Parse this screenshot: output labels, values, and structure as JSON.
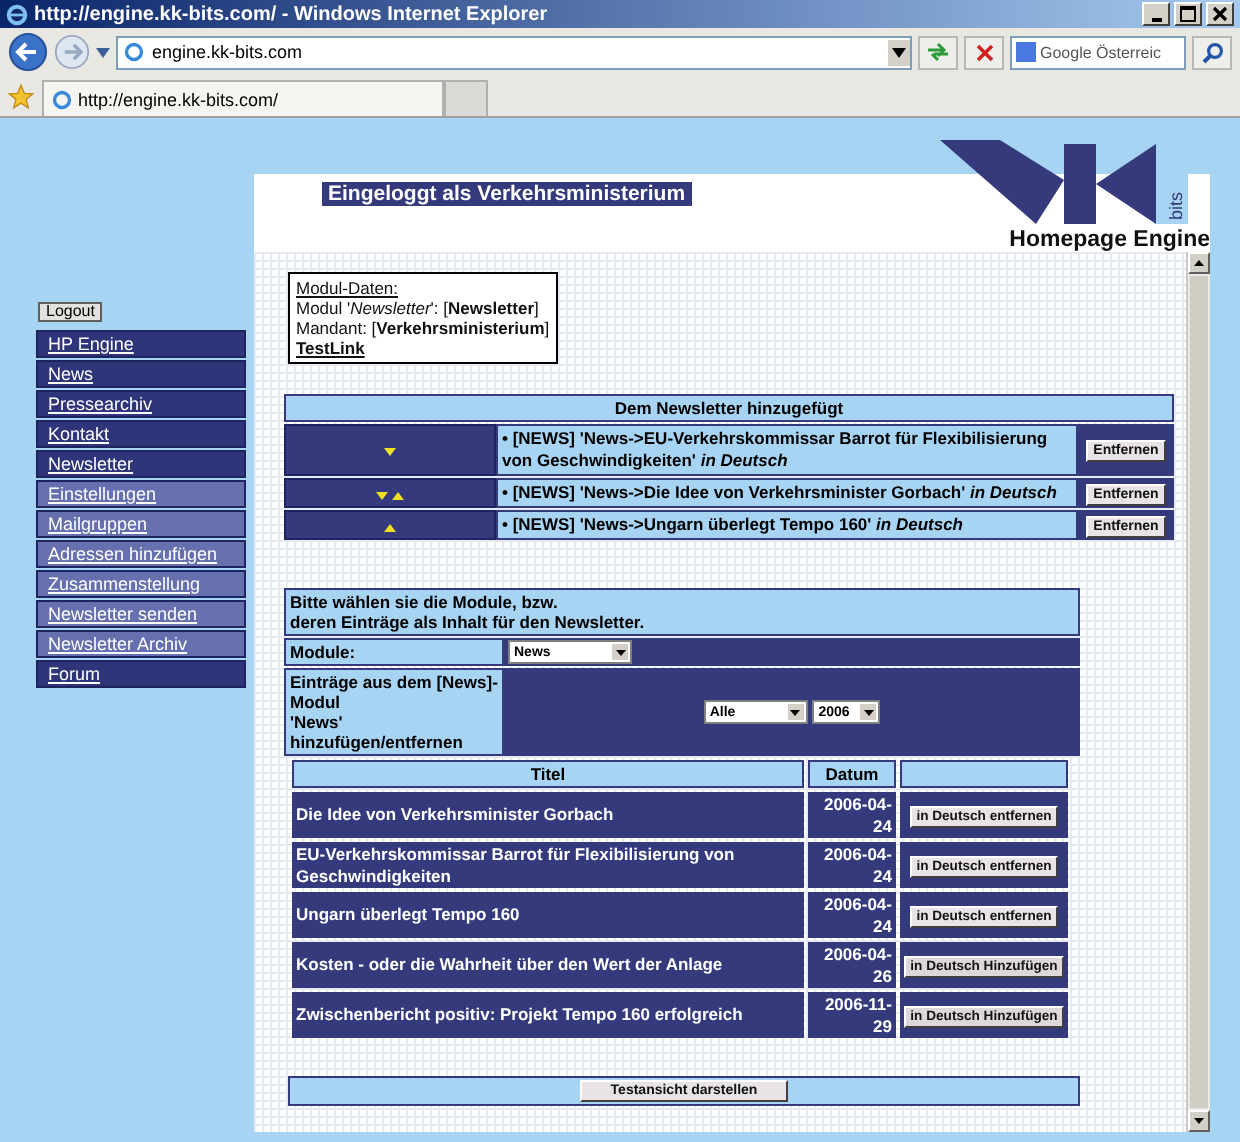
{
  "browser": {
    "title": "http://engine.kk-bits.com/ - Windows Internet Explorer",
    "address": "engine.kk-bits.com",
    "search_placeholder": "Google Österreic",
    "tab": "http://engine.kk-bits.com/"
  },
  "header": {
    "logged_in": "Eingeloggt als Verkehrsministerium",
    "logo_text": "bits",
    "product": "Homepage Engine"
  },
  "logout": "Logout",
  "nav": [
    {
      "label": "HP Engine",
      "kind": "main"
    },
    {
      "label": "News",
      "kind": "main"
    },
    {
      "label": "Pressearchiv",
      "kind": "main"
    },
    {
      "label": "Kontakt",
      "kind": "main"
    },
    {
      "label": "Newsletter",
      "kind": "main"
    },
    {
      "label": "Einstellungen",
      "kind": "sub"
    },
    {
      "label": "Mailgruppen",
      "kind": "sub"
    },
    {
      "label": "Adressen hinzufügen",
      "kind": "sub"
    },
    {
      "label": "Zusammenstellung",
      "kind": "sub"
    },
    {
      "label": "Newsletter senden",
      "kind": "sub"
    },
    {
      "label": "Newsletter Archiv",
      "kind": "sub"
    },
    {
      "label": "Forum",
      "kind": "main"
    }
  ],
  "module_info": {
    "heading": "Modul-Daten:",
    "lines": [
      "Modul '*Newsletter*': [**Newsletter**]",
      "Mandant: [**Verkehrsministerium**]"
    ],
    "link": "TestLink"
  },
  "newsletter": {
    "heading": "Dem Newsletter hinzugefügt",
    "items": [
      {
        "text": "• [NEWS] 'News->EU-Verkehrskommissar Barrot für Flexibilisierung von Geschwindigkeiten' *in Deutsch*",
        "move_down": true,
        "move_up": false,
        "button": "Entfernen"
      },
      {
        "text": "• [NEWS] 'News->Die Idee von Verkehrsminister Gorbach' *in Deutsch*",
        "move_down": true,
        "move_up": true,
        "button": "Entfernen"
      },
      {
        "text": "• [NEWS] 'News->Ungarn überlegt Tempo 160' *in Deutsch*",
        "move_down": false,
        "move_up": true,
        "button": "Entfernen"
      }
    ]
  },
  "selection": {
    "intro_lines": [
      "Bitte wählen sie die Module, bzw.",
      "deren Einträge als Inhalt für den Newsletter."
    ],
    "module_label": "Module:",
    "module_value": "News",
    "entries_label_lines": [
      "Einträge aus dem [News]-",
      "Modul",
      "'News'",
      "hinzufügen/entfernen"
    ],
    "filter_value": "Alle",
    "year_value": "2006"
  },
  "articles": {
    "columns": [
      "Titel",
      "Datum"
    ],
    "rows": [
      {
        "title": "Die Idee von Verkehrsminister Gorbach",
        "date": "2006-04-24",
        "action": "in Deutsch entfernen",
        "in_newsletter": true
      },
      {
        "title": "EU-Verkehrskommissar Barrot für Flexibilisierung von Geschwindigkeiten",
        "date": "2006-04-24",
        "action": "in Deutsch entfernen",
        "in_newsletter": true
      },
      {
        "title": "Ungarn überlegt Tempo 160",
        "date": "2006-04-24",
        "action": "in Deutsch entfernen",
        "in_newsletter": true
      },
      {
        "title": "Kosten - oder die Wahrheit über den Wert der Anlage",
        "date": "2006-04-26",
        "action": "in Deutsch Hinzufügen",
        "in_newsletter": false
      },
      {
        "title": "Zwischenbericht positiv: Projekt Tempo 160 erfolgreich",
        "date": "2006-11-29",
        "action": "in Deutsch Hinzufügen",
        "in_newsletter": false
      }
    ]
  },
  "preview_button": "Testansicht darstellen"
}
